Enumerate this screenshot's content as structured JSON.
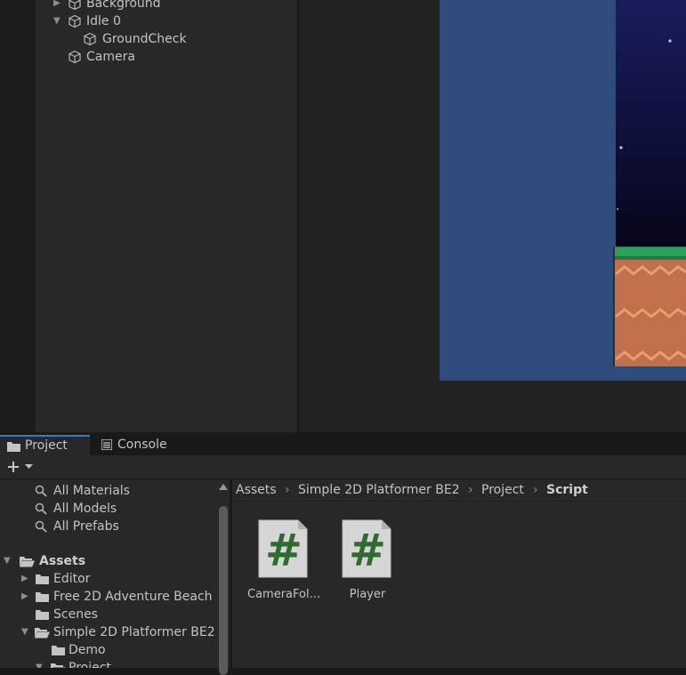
{
  "hierarchy": {
    "items": [
      {
        "label": "Background",
        "expand": "▶"
      },
      {
        "label": "Idle 0",
        "expand": "▼"
      },
      {
        "label": "GroundCheck"
      },
      {
        "label": "Camera"
      }
    ]
  },
  "project_panel": {
    "tabs": [
      {
        "label": "Project",
        "icon": "folder-icon"
      },
      {
        "label": "Console",
        "icon": "console-list-icon"
      }
    ],
    "toolbar": {
      "add_icon": "plus-icon",
      "dropdown_icon": "triangle-down-icon"
    },
    "favorites": [
      {
        "label": "All Materials",
        "icon": "search-icon"
      },
      {
        "label": "All Models",
        "icon": "search-icon"
      },
      {
        "label": "All Prefabs",
        "icon": "search-icon"
      }
    ],
    "tree": {
      "root": {
        "label": "Assets",
        "expand": "▼"
      },
      "children": [
        {
          "label": "Editor",
          "expand": "▶"
        },
        {
          "label": "Free 2D Adventure Beach",
          "expand": "▶"
        },
        {
          "label": "Scenes",
          "expand": ""
        },
        {
          "label": "Simple 2D Platformer BE2",
          "expand": "▼"
        },
        {
          "label": "Demo",
          "expand": ""
        },
        {
          "label": "Project",
          "expand": "▼"
        }
      ]
    },
    "breadcrumb": {
      "items": [
        "Assets",
        "Simple 2D Platformer BE2",
        "Project"
      ],
      "separator": "›",
      "current": "Script"
    },
    "assets": [
      {
        "label": "CameraFol...",
        "glyph": "#"
      },
      {
        "label": "Player",
        "glyph": "#"
      }
    ]
  },
  "colors": {
    "panel": "#282828",
    "accent_tab": "#3a79bb",
    "game_view": "#2f4b7a",
    "grass": "#2aa05a",
    "dirt": "#c0704a",
    "script_glyph": "#2f6b2f"
  }
}
